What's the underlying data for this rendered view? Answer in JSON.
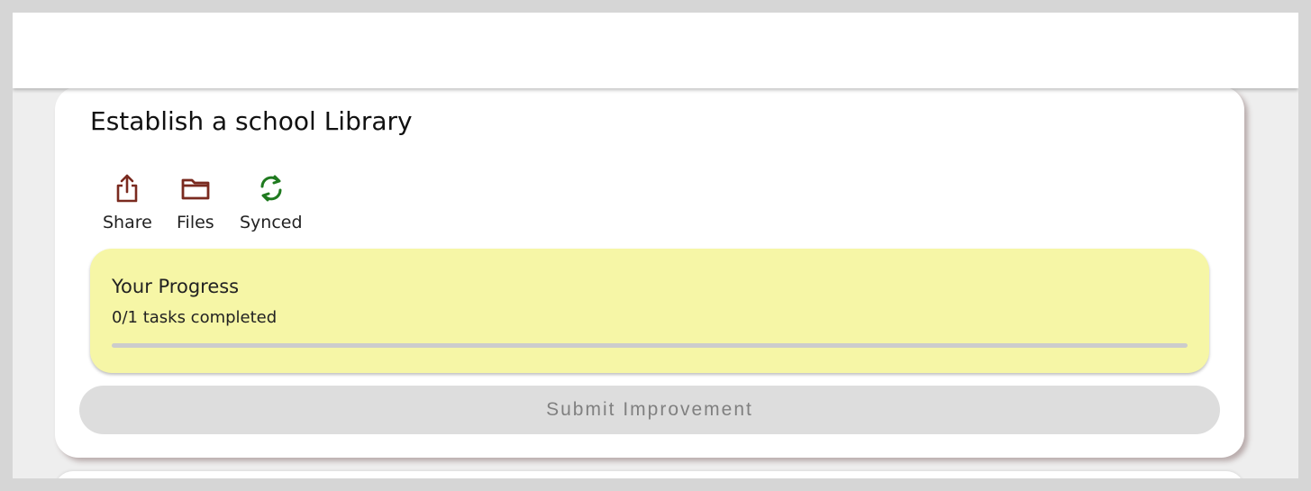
{
  "card": {
    "title": "Establish a school Library",
    "actions": [
      {
        "label": "Share",
        "icon": "share-icon",
        "color": "#7a2a1f"
      },
      {
        "label": "Files",
        "icon": "folder-icon",
        "color": "#7a2a1f"
      },
      {
        "label": "Synced",
        "icon": "sync-icon",
        "color": "#1f7a1f"
      }
    ],
    "progress": {
      "title": "Your Progress",
      "status_text": "0/1 tasks completed",
      "fraction": 0,
      "background": "#f6f6a6"
    },
    "submit_label": "Submit Improvement"
  }
}
